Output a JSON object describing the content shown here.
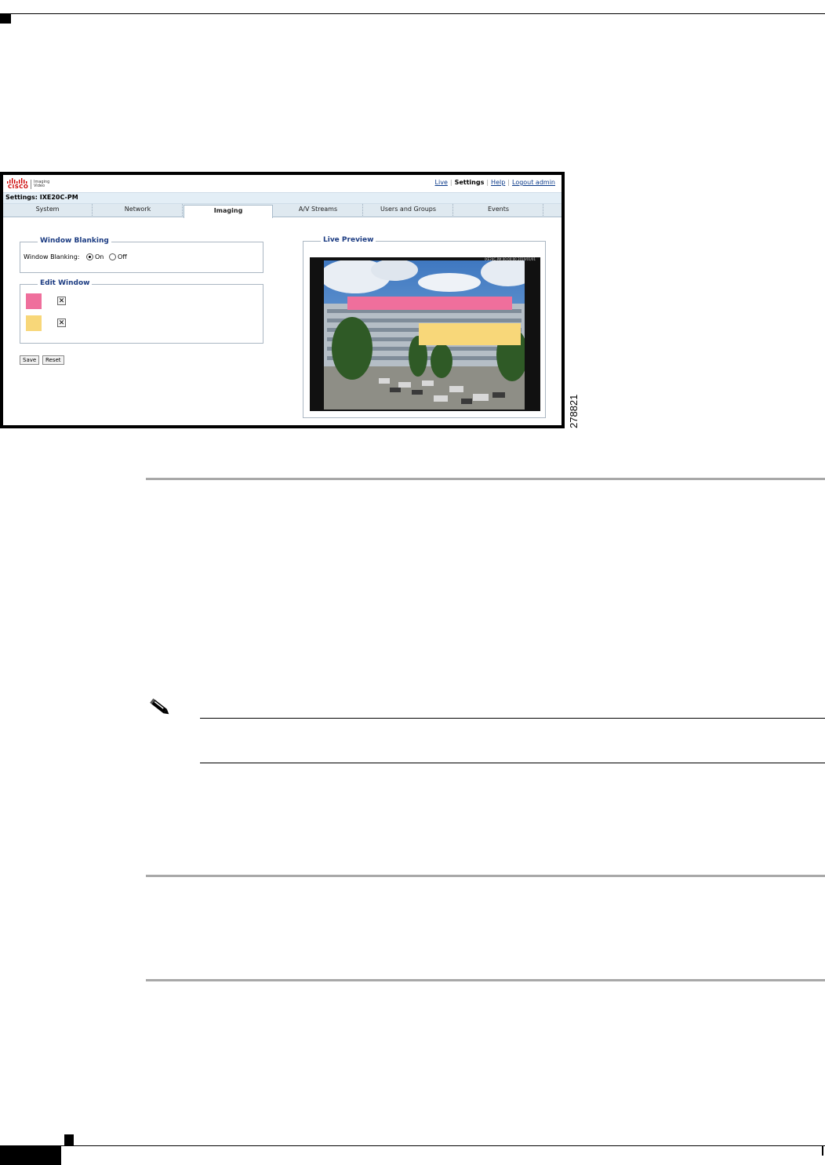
{
  "document": {
    "figure_id": "278821"
  },
  "app": {
    "brand": "CISCO",
    "logo_sub": "Imaging Video",
    "settings_title": "Settings: IXE20C-PM"
  },
  "topnav": {
    "live": "Live",
    "settings": "Settings",
    "help": "Help",
    "logout": "Logout admin"
  },
  "tabs": [
    {
      "label": "System"
    },
    {
      "label": "Network"
    },
    {
      "label": "Imaging",
      "active": true
    },
    {
      "label": "A/V Streams"
    },
    {
      "label": "Users and Groups"
    },
    {
      "label": "Events"
    }
  ],
  "window_blanking": {
    "title": "Window Blanking",
    "label": "Window Blanking:",
    "on_label": "On",
    "off_label": "Off",
    "selected": "On"
  },
  "edit_window": {
    "title": "Edit Window",
    "windows": [
      {
        "color": "#ef6f9c",
        "delete": "✕"
      },
      {
        "color": "#f8d779",
        "delete": "✕"
      }
    ]
  },
  "buttons": {
    "save": "Save",
    "reset": "Reset"
  },
  "preview": {
    "title": "Live Preview",
    "overlay_text": "IXE20C-PM 00:00:00 2010/01/01",
    "mask_colors": [
      "#ef6f9c",
      "#f8d779"
    ]
  }
}
